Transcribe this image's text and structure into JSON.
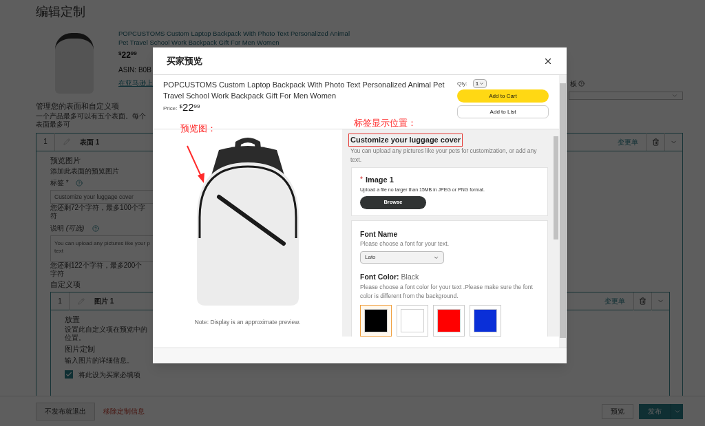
{
  "page_title": "编辑定制",
  "product": {
    "title": "POPCUSTOMS Custom Laptop Backpack With Photo Text Personalized Animal Pet Travel School Work Backpack Gift For Men Women",
    "price_symbol": "$",
    "price_whole": "22",
    "price_fraction": "99",
    "asin": "ASIN: B0B",
    "amazon_link": "在亚马逊上"
  },
  "right_field_label": "板",
  "surfaces_section": {
    "title": "管理您的表面和自定义项",
    "subtitle": "一个产品最多可以有五个表面。每个表面最多可"
  },
  "surface": {
    "index": "1",
    "name": "表面 1",
    "change_link": "变更单",
    "preview_title": "预览图片",
    "preview_hint": "添加此表面的预览图片",
    "label_field": {
      "label": "标签",
      "required_mark": "*",
      "value": "Customize your luggage cover",
      "counter": "您还剩72个字符，最多100个字符"
    },
    "description_field": {
      "label": "说明",
      "optional_note": "(可选)",
      "value_lines": [
        "You can upload any pictures like your p",
        "text"
      ],
      "counter": "您还剩122个字符，最多200个字符"
    },
    "customizations_title": "自定义项",
    "customization": {
      "index": "1",
      "name": "图片 1",
      "change_link": "变更单",
      "placement_title": "放置",
      "placement_hint": "设置此自定义项在预览中的位置。",
      "image_title": "图片定制",
      "image_hint": "输入图片的详细信息。",
      "required_checkbox": {
        "label": "将此设为买家必填项",
        "checked": true
      }
    }
  },
  "footer": {
    "exit_button": "不发布就退出",
    "remove_link": "移除定制信息",
    "preview_button": "预览",
    "publish_button": "发布"
  },
  "modal": {
    "title": "买家预览",
    "product": {
      "title": "POPCUSTOMS Custom Laptop Backpack With Photo Text Personalized Animal Pet Travel School Work Backpack Gift For Men Women",
      "price_label": "Price:",
      "price_symbol": "$",
      "price_whole": "22",
      "price_fraction": "99",
      "qty_label": "Qty:",
      "qty_value": "1",
      "add_to_cart": "Add to Cart",
      "add_to_list": "Add to List"
    },
    "preview_note": "Note: Display is an approximate preview.",
    "annotations": {
      "preview": "预览图：",
      "label_position": "标签显示位置："
    },
    "customization": {
      "title": "Customize your luggage cover",
      "description": "You can upload any pictures like your pets for customization, or add any text.",
      "image_card": {
        "required_mark": "*",
        "title": "Image 1",
        "hint": "Upload a file no larger than 15MB in JPEG or PNG format.",
        "browse_button": "Browse"
      },
      "font_card": {
        "font_name_title": "Font Name",
        "font_name_hint": "Please choose a font for your text.",
        "font_value": "Lato",
        "font_color_title": "Font Color:",
        "font_color_value": "Black",
        "font_color_hint": "Please choose a font color for your text .Please make sure the font color is different from the background.",
        "swatches": [
          {
            "color": "#000000",
            "selected": true
          },
          {
            "color": "#ffffff",
            "selected": false
          },
          {
            "color": "#ff0000",
            "selected": false
          },
          {
            "color": "#0a2fd8",
            "selected": false
          }
        ]
      }
    }
  }
}
